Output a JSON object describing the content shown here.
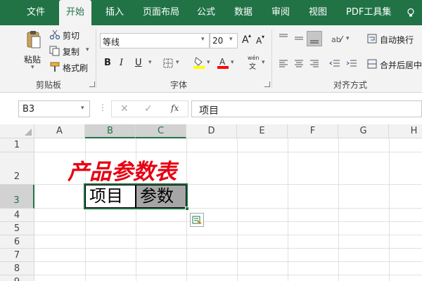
{
  "tabs": {
    "file": "文件",
    "home": "开始",
    "insert": "插入",
    "layout": "页面布局",
    "formulas": "公式",
    "data": "数据",
    "review": "审阅",
    "view": "视图",
    "pdf": "PDF工具集"
  },
  "clipboard": {
    "paste": "粘贴",
    "cut": "剪切",
    "copy": "复制",
    "painter": "格式刷",
    "group": "剪贴板"
  },
  "font": {
    "name": "等线",
    "size": "20",
    "bold": "B",
    "italic": "I",
    "underline": "U",
    "group": "字体",
    "increase": "A",
    "decrease": "A",
    "phonetic": "wén"
  },
  "alignment": {
    "wrap": "自动换行",
    "merge": "合并后居中",
    "group": "对齐方式"
  },
  "formula_bar": {
    "name_box": "B3",
    "fx": "fx",
    "content": "项目"
  },
  "grid": {
    "columns": [
      "A",
      "B",
      "C",
      "D",
      "E",
      "F",
      "G",
      "H"
    ],
    "rows": [
      "1",
      "2",
      "3",
      "4",
      "5",
      "6",
      "7",
      "8",
      "9"
    ],
    "title_text": "产品参数表",
    "b3": "项目",
    "c3": "参数"
  },
  "colors": {
    "excel_green": "#217346",
    "title_red": "#e60012",
    "highlight_fill": "#a6a6a6",
    "font_color_bar": "#ff0000",
    "fill_color_bar": "#ffff00"
  }
}
